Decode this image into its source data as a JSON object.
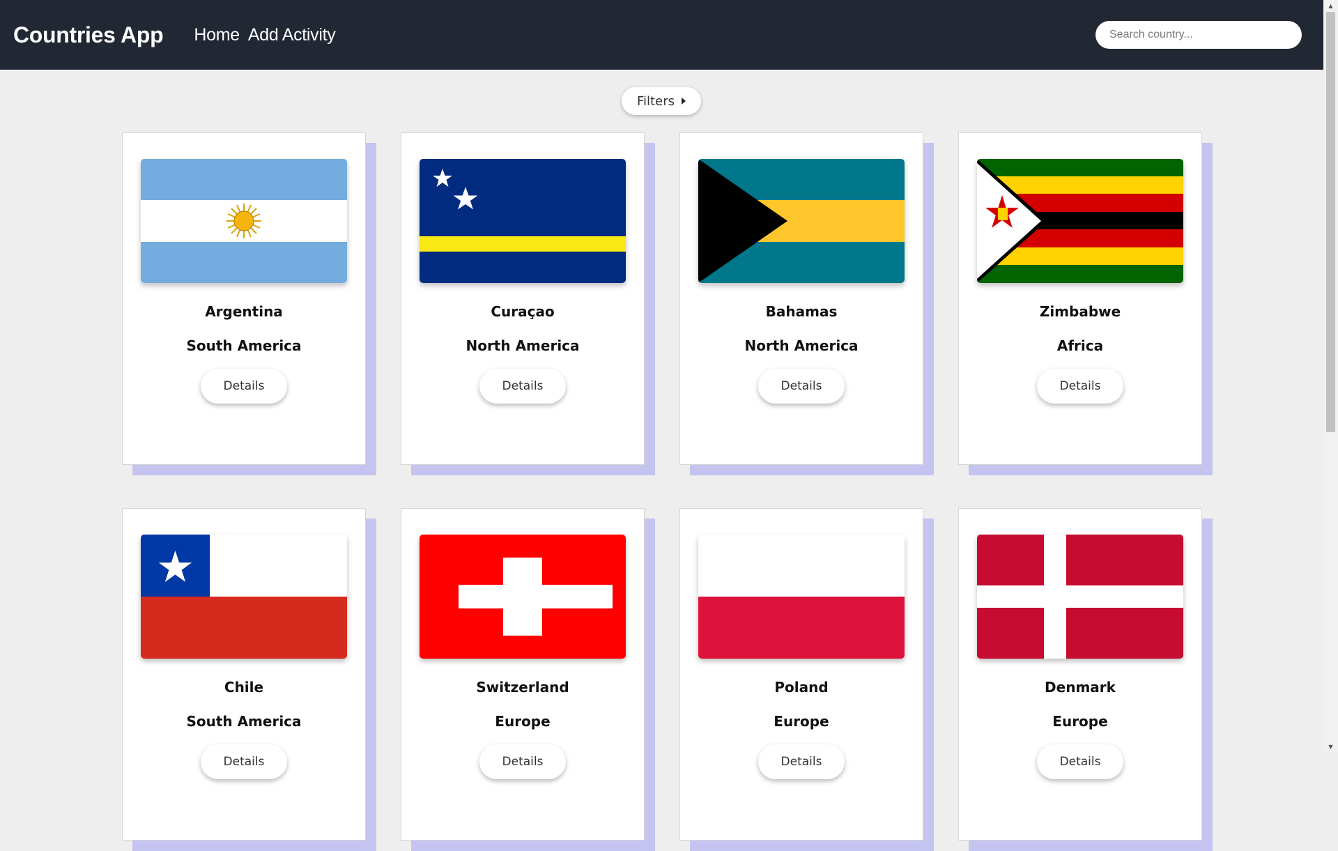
{
  "header": {
    "brand": "Countries App",
    "nav": [
      "Home",
      "Add Activity"
    ],
    "search_placeholder": "Search country..."
  },
  "filters": {
    "label": "Filters"
  },
  "cards": [
    {
      "name": "Argentina",
      "continent": "South America",
      "button": "Details",
      "flag": "argentina"
    },
    {
      "name": "Curaçao",
      "continent": "North America",
      "button": "Details",
      "flag": "curacao"
    },
    {
      "name": "Bahamas",
      "continent": "North America",
      "button": "Details",
      "flag": "bahamas"
    },
    {
      "name": "Zimbabwe",
      "continent": "Africa",
      "button": "Details",
      "flag": "zimbabwe"
    },
    {
      "name": "Chile",
      "continent": "South America",
      "button": "Details",
      "flag": "chile"
    },
    {
      "name": "Switzerland",
      "continent": "Europe",
      "button": "Details",
      "flag": "switzerland"
    },
    {
      "name": "Poland",
      "continent": "Europe",
      "button": "Details",
      "flag": "poland"
    },
    {
      "name": "Denmark",
      "continent": "Europe",
      "button": "Details",
      "flag": "denmark"
    }
  ],
  "colors": {
    "navbar": "#212733",
    "page_background": "#eeeeee",
    "card_shadow": "#c5c3ef"
  }
}
